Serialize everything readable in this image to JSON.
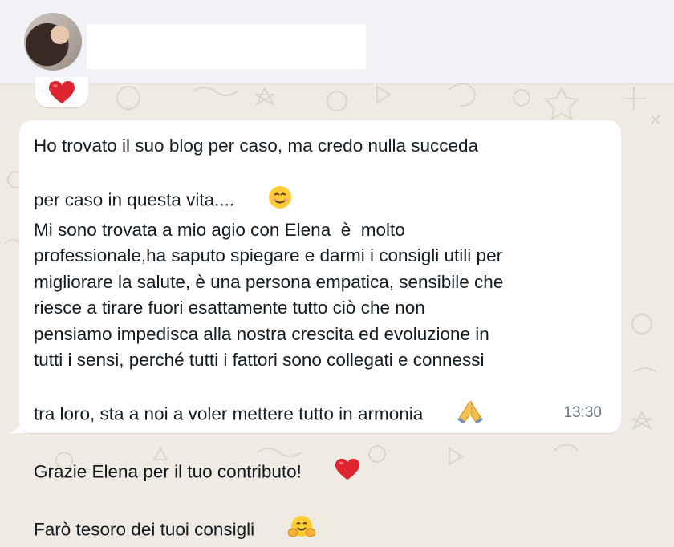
{
  "message": {
    "lines": [
      "Ho trovato il suo blog per caso, ma credo nulla succeda",
      "per caso in questa vita....",
      "Mi sono trovata a mio agio con Elena  è  molto",
      "professionale,ha saputo spiegare e darmi i consigli utili per",
      "migliorare la salute, è una persona empatica, sensibile che",
      "riesce a tirare fuori esattamente tutto ciò che non",
      "pensiamo impedisca alla nostra crescita ed evoluzione in",
      "tutti i sensi, perché tutti i fattori sono collegati e connessi",
      "tra loro, sta a noi a voler mettere tutto in armonia",
      "Grazie Elena per il tuo contributo!",
      "Farò tesoro dei tuoi consigli"
    ],
    "timestamp": "13:30"
  },
  "reaction": {
    "icon": "heart-icon"
  },
  "icons": {
    "line_2": "smiling-face-icon",
    "line_9": "folded-hands-icon",
    "line_10": "red-heart-icon",
    "line_11": "hugging-face-icon"
  },
  "colors": {
    "header_bg": "#f0f2f5",
    "chat_bg": "#efeae2",
    "bubble_bg": "#ffffff",
    "text": "#111b21",
    "timestamp": "#667781",
    "heart": "#e0242f"
  }
}
